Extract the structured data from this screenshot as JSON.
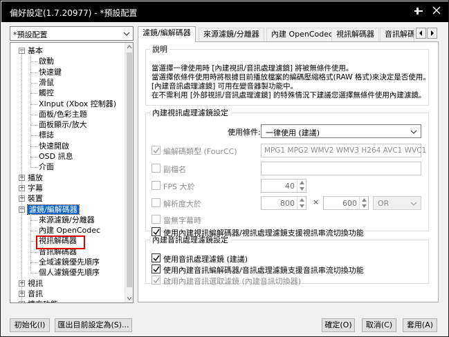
{
  "window": {
    "title": "偏好設定(1.7.20977) - *預設配置",
    "pin_icon": "pin-icon",
    "close_icon": "close-icon"
  },
  "preset": {
    "value": "*預設配置"
  },
  "tree": {
    "items": [
      {
        "label": "基本",
        "level": 0,
        "expander": "−"
      },
      {
        "label": "啟動",
        "level": 1
      },
      {
        "label": "快速鍵",
        "level": 1
      },
      {
        "label": "滑鼠",
        "level": 1
      },
      {
        "label": "觸控",
        "level": 1
      },
      {
        "label": "XInput (Xbox 控制器)",
        "level": 1
      },
      {
        "label": "面板/色彩主題",
        "level": 1
      },
      {
        "label": "面板顯示/放大",
        "level": 1
      },
      {
        "label": "標誌",
        "level": 1
      },
      {
        "label": "快速開啟",
        "level": 1
      },
      {
        "label": "OSD 訊息",
        "level": 1
      },
      {
        "label": "介面",
        "level": 1
      },
      {
        "label": "播放",
        "level": 0,
        "expander": "+"
      },
      {
        "label": "字幕",
        "level": 0,
        "expander": "+"
      },
      {
        "label": "裝置",
        "level": 0,
        "expander": "+"
      },
      {
        "label": "濾鏡/編解碼器",
        "level": 0,
        "expander": "−",
        "selected": true
      },
      {
        "label": "來源濾鏡/分離器",
        "level": 1
      },
      {
        "label": "內建 OpenCodec",
        "level": 1
      },
      {
        "label": "視訊解碼器",
        "level": 1,
        "highlighted": true
      },
      {
        "label": "音訊解碼器",
        "level": 1
      },
      {
        "label": "全域濾鏡優先順序",
        "level": 1
      },
      {
        "label": "個人濾鏡優先順序",
        "level": 1
      },
      {
        "label": "視訊",
        "level": 0,
        "expander": "+"
      },
      {
        "label": "音訊",
        "level": 0,
        "expander": "+"
      },
      {
        "label": "擴充功能",
        "level": 0,
        "expander": "+"
      }
    ]
  },
  "tabs": [
    {
      "label": "濾鏡/編解碼器",
      "active": true
    },
    {
      "label": "來源濾鏡/分離器"
    },
    {
      "label": "內建 OpenCodec"
    },
    {
      "label": "視訊解碼器"
    },
    {
      "label": "音訊解碼"
    }
  ],
  "description": {
    "legend": "說明",
    "text": "當選擇一律使用時 [內建視訊/音訊處理濾鏡] 將被無條件使用。\n當選擇依條件使用時將根據目前播放檔案的編碼壓縮格式(RAW 格式)來決定是否使用。[內建音訊處理濾鏡] 可用在變音器製功能中。\n在不需利用 [外部視訊/音訊處理濾鏡] 的特殊情況下建議您選擇無條件使用內建濾鏡。"
  },
  "video_group": {
    "legend": "內建視訊處理濾鏡設定",
    "use_condition_label": "使用條件:",
    "use_condition_value": "一律使用 (建議)",
    "fourcc_label": "編解碼類型 (FourCC)",
    "fourcc_value": "MPG1 MPG2 WMV2 WMV3 H264 AVC1 WVC1",
    "fourcc_checked": true,
    "ext_label": "副檔名",
    "ext_value": "",
    "fps_label": "FPS 大於",
    "fps_value": "40",
    "res_label": "解析度大於",
    "res_w": "800",
    "res_times": "×",
    "res_h": "600",
    "res_op": "OR",
    "no_subs_label": "當無字幕時",
    "use_builtin_video_label": "使用內建視訊編解碼器/視訊處理濾鏡支援視訊串流切換功能",
    "use_builtin_video_checked": true
  },
  "audio_group": {
    "legend": "內建音訊處理濾鏡設定",
    "use_audio_filter_label": "使用音訊處理濾鏡 (建議)",
    "use_audio_filter_checked": true,
    "use_builtin_audio_label": "使用內建音訊編解碼器/音訊處理濾鏡支援音訊串流切換功能",
    "use_builtin_audio_checked": true,
    "enable_switcher_label": "啟用內建音訊選取濾鏡 (內建音訊切換器)",
    "enable_switcher_checked": true
  },
  "buttons": {
    "init": "初始化(I)",
    "export": "匯出目前設定為(S)...",
    "ok": "確定(O)",
    "cancel": "取消(C)",
    "apply": "套用(A)"
  }
}
